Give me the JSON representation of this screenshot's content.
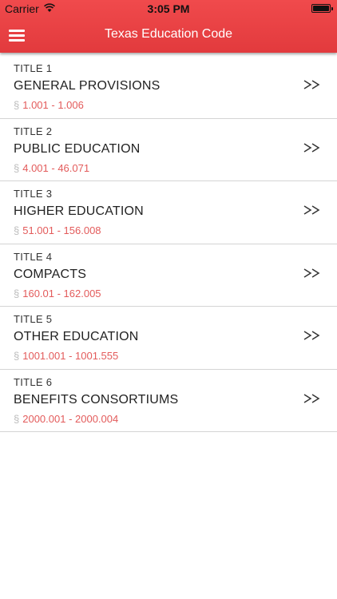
{
  "status_bar": {
    "carrier": "Carrier",
    "time": "3:05 PM"
  },
  "nav": {
    "title": "Texas Education Code",
    "menu_icon": "hamburger-menu-icon",
    "background_color": "#ec4446",
    "title_color": "#ffffff"
  },
  "section_symbol": "§",
  "colors": {
    "range_text": "#e35b5b",
    "section_symbol": "#bdbdbd",
    "divider": "#d4d4d4"
  },
  "titles": [
    {
      "number": "TITLE 1",
      "name": "GENERAL PROVISIONS",
      "range": "1.001 - 1.006"
    },
    {
      "number": "TITLE 2",
      "name": "PUBLIC EDUCATION",
      "range": "4.001 - 46.071"
    },
    {
      "number": "TITLE 3",
      "name": "HIGHER EDUCATION",
      "range": "51.001 - 156.008"
    },
    {
      "number": "TITLE 4",
      "name": "COMPACTS",
      "range": "160.01 - 162.005"
    },
    {
      "number": "TITLE 5",
      "name": "OTHER EDUCATION",
      "range": "1001.001 - 1001.555"
    },
    {
      "number": "TITLE 6",
      "name": "BENEFITS CONSORTIUMS",
      "range": "2000.001 - 2000.004"
    }
  ]
}
